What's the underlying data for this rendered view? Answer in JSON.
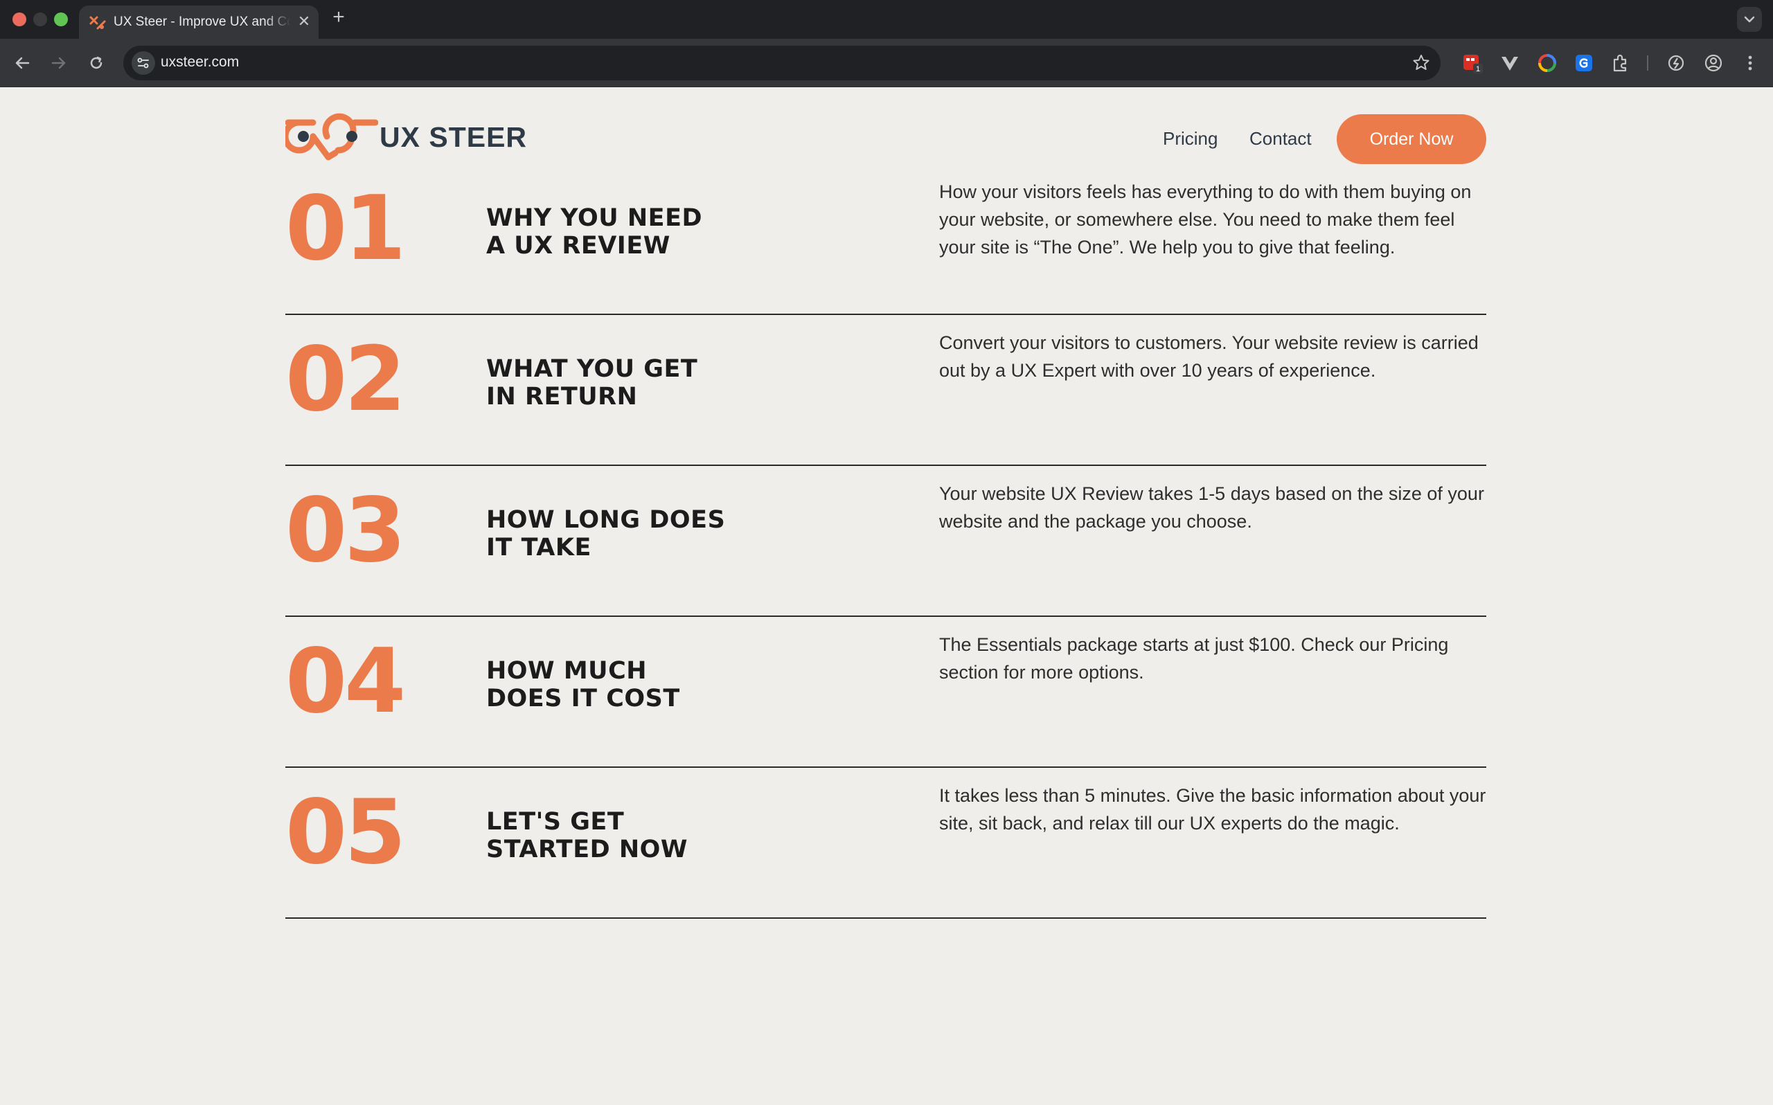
{
  "browser": {
    "tab_title": "UX Steer - Improve UX and Conversions",
    "tab_close": "✕",
    "new_tab": "+",
    "url": "uxsteer.com",
    "extension_badge": "1"
  },
  "site": {
    "brand": "UX STEER",
    "nav": {
      "pricing": "Pricing",
      "contact": "Contact",
      "order": "Order Now"
    },
    "accent_color": "#ec7b4c",
    "text_color": "#2e3a45"
  },
  "items": [
    {
      "number": "01",
      "title_line1": "WHY YOU NEED",
      "title_line2": "A UX REVIEW",
      "description": "How your visitors feels has everything to do with them buying on your website, or somewhere else. You need to make them feel your site is “The One”. We help you to give that feeling."
    },
    {
      "number": "02",
      "title_line1": "WHAT YOU GET",
      "title_line2": "IN RETURN",
      "description": "Convert your visitors to customers. Your website review is carried out by a UX Expert with over 10 years of experience."
    },
    {
      "number": "03",
      "title_line1": "HOW LONG DOES",
      "title_line2": "IT TAKE",
      "description": "Your website UX Review takes 1-5 days based on the size of your website and the package you choose."
    },
    {
      "number": "04",
      "title_line1": "HOW MUCH",
      "title_line2": "DOES IT COST",
      "description": "The Essentials package starts at just $100. Check our Pricing section for more options."
    },
    {
      "number": "05",
      "title_line1": "LET'S GET",
      "title_line2": "STARTED NOW",
      "description": "It takes less than 5 minutes. Give the basic information about your site, sit back, and relax till our UX experts do the magic."
    }
  ]
}
